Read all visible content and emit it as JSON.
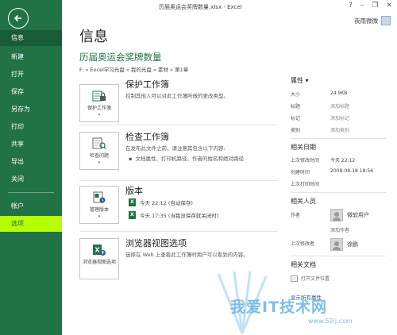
{
  "window": {
    "title": "历届奥运会奖牌数量.xlsx - Excel"
  },
  "account": {
    "name": "夜雨微微"
  },
  "nav": {
    "items": [
      {
        "label": "信息"
      },
      {
        "label": "新建"
      },
      {
        "label": "打开"
      },
      {
        "label": "保存"
      },
      {
        "label": "另存为"
      },
      {
        "label": "打印"
      },
      {
        "label": "共享"
      },
      {
        "label": "导出"
      },
      {
        "label": "关闭"
      },
      {
        "label": "帐户"
      },
      {
        "label": "选项"
      }
    ]
  },
  "page": {
    "title": "信息",
    "workbook_title": "历届奥运会奖牌数量",
    "path": "F: » Excel学习光盘 » 我的光盘 » 素材 » 第1章"
  },
  "sections": {
    "protect": {
      "button_label": "保护工作簿",
      "title": "保护工作簿",
      "desc": "控制其他人可以对此工作簿所做的更改类型。"
    },
    "inspect": {
      "button_label": "检查问题",
      "title": "检查工作簿",
      "desc": "在发布此文件之前，请注意其包含以下内容:",
      "bullet": "文档属性、打印机路径、作者的姓名和绝对路径"
    },
    "versions": {
      "button_label": "管理版本",
      "title": "版本",
      "entries": [
        "今天 22:12 (自动保存)",
        "今天 17:35 (当我没保存就关闭时)"
      ]
    },
    "browser": {
      "button_label": "浏览器视图选项",
      "title": "浏览器视图选项",
      "desc": "选择在 Web 上查看此工作簿时用户可以看到的内容。"
    }
  },
  "properties": {
    "heading": "属性 ▾",
    "rows": [
      {
        "label": "大小",
        "value": "24.9KB"
      },
      {
        "label": "标题",
        "value": "添加标题"
      },
      {
        "label": "标记",
        "value": "添加标记"
      },
      {
        "label": "类别",
        "value": "添加类别"
      }
    ],
    "dates_heading": "相关日期",
    "dates": [
      {
        "label": "上次修改时间",
        "value": "今天 22:12"
      },
      {
        "label": "创建时间",
        "value": "2008-08-18 18:56"
      },
      {
        "label": "上次打印时间",
        "value": ""
      }
    ],
    "people_heading": "相关人员",
    "author_label": "作者",
    "author_name": "微软用户",
    "add_author": "添加作者",
    "last_modified_by_label": "上次修改者",
    "last_modified_by": "徐鹏",
    "docs_heading": "相关文档",
    "open_location": "打开文件位置",
    "show_all": "显示所有属性"
  },
  "watermark": {
    "text": "我爱IT技术网",
    "url": "www.52ij.com"
  }
}
